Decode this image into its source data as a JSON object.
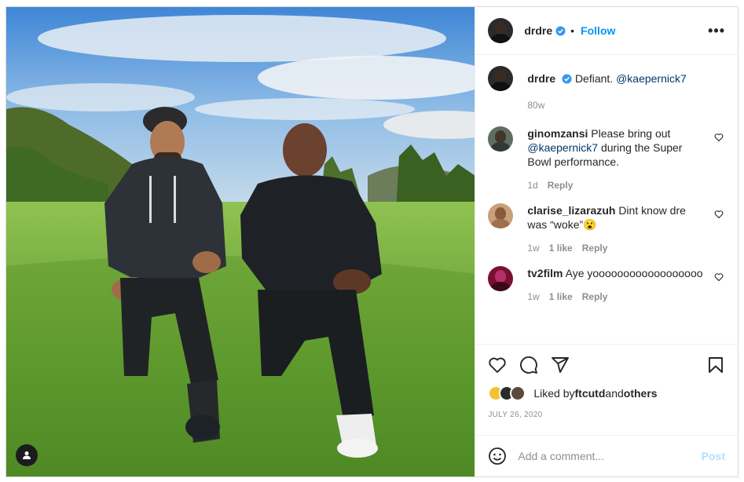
{
  "post": {
    "username": "drdre",
    "follow_label": "Follow",
    "separator": "•",
    "more_label": "•••"
  },
  "caption": {
    "username": "drdre",
    "text": "Defiant. ",
    "mention": "@kaepernick7",
    "time": "80w"
  },
  "comments": [
    {
      "username": "ginomzansi",
      "text_before": "Please bring out ",
      "mention": "@kaepernick7",
      "text_after": " during the Super Bowl performance.",
      "time": "1d",
      "likes": "",
      "reply_label": "Reply"
    },
    {
      "username": "clarise_lizarazuh",
      "text_before": "Dint know dre was “woke”",
      "emoji": "😮",
      "time": "1w",
      "likes": "1 like",
      "reply_label": "Reply"
    },
    {
      "username": "tv2film",
      "text_before": "Aye yoooooooooooooooooo",
      "time": "1w",
      "likes": "1 like",
      "reply_label": "Reply"
    }
  ],
  "likes": {
    "prefix": "Liked by ",
    "user": "ftcutd",
    "middle": " and ",
    "others": "others"
  },
  "date": "JULY 26, 2020",
  "composer": {
    "placeholder": "Add a comment...",
    "post_label": "Post"
  },
  "icons": {
    "verified": "verified-badge-icon",
    "heart": "heart-icon",
    "comment": "comment-icon",
    "share": "share-icon",
    "save": "bookmark-icon",
    "emoji": "smiley-icon",
    "user_tag": "user-tag-icon"
  },
  "colors": {
    "accent": "#0095f6",
    "verified": "#3897f0",
    "mention": "#00376b",
    "muted": "#8e8e8e",
    "post_disabled": "#b2dffc"
  }
}
